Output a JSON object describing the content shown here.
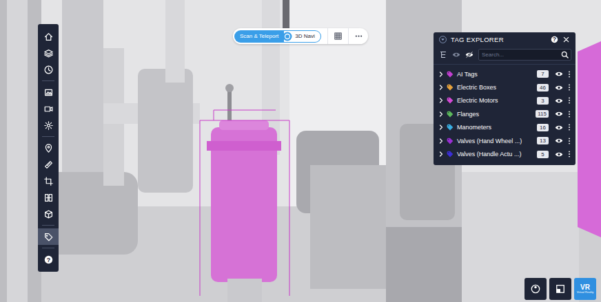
{
  "mode_switch": {
    "options": [
      {
        "label": "Scan & Teleport",
        "selected": true
      },
      {
        "label": "3D Navi",
        "selected": false
      }
    ]
  },
  "sidebar": {
    "groups": [
      [
        {
          "selected": false
        },
        {
          "selected": false
        },
        {
          "selected": false
        }
      ],
      [
        {
          "selected": false
        },
        {
          "selected": false
        },
        {
          "selected": false
        }
      ],
      [
        {
          "selected": false
        },
        {
          "selected": false
        },
        {
          "selected": false
        },
        {
          "selected": false
        },
        {
          "selected": false
        }
      ],
      [
        {
          "selected": true
        }
      ],
      [
        {
          "selected": false,
          "label": "?"
        }
      ]
    ]
  },
  "tag_explorer": {
    "title": "TAG EXPLORER",
    "help": "?",
    "search": {
      "placeholder": "Search..."
    },
    "categories": [
      {
        "label": "AI Tags",
        "count": "7",
        "color": "#c33fd2",
        "visible": true,
        "expanded": false
      },
      {
        "label": "Electric Boxes",
        "count": "46",
        "color": "#e6a23c",
        "visible": true,
        "expanded": false
      },
      {
        "label": "Electric Motors",
        "count": "3",
        "color": "#d44ad6",
        "visible": true,
        "expanded": false
      },
      {
        "label": "Flanges",
        "count": "115",
        "color": "#5cb85c",
        "visible": true,
        "expanded": false
      },
      {
        "label": "Manometers",
        "count": "16",
        "color": "#3aaee2",
        "visible": true,
        "expanded": false
      },
      {
        "label": "Valves (Hand Wheel ...)",
        "count": "13",
        "color": "#9a2fd4",
        "visible": true,
        "expanded": false
      },
      {
        "label": "Valves (Handle Actu ...)",
        "count": "5",
        "color": "#3b2ed6",
        "visible": true,
        "expanded": false
      }
    ]
  },
  "bottom_controls": {
    "vr": {
      "label": "VR",
      "caption": "Virtual Reality"
    }
  }
}
